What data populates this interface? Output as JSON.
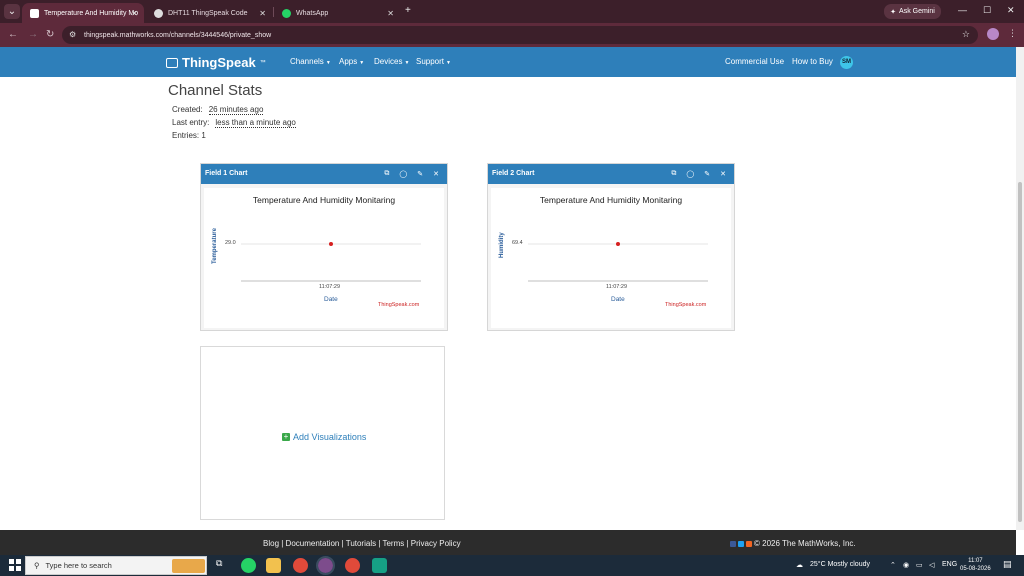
{
  "browser": {
    "tabs": [
      {
        "title": "Temperature And Humidity Mo",
        "active": true
      },
      {
        "title": "DHT11 ThingSpeak Code",
        "active": false
      },
      {
        "title": "WhatsApp",
        "active": false
      }
    ],
    "ask_gemini": "Ask Gemini",
    "url": "thingspeak.mathworks.com/channels/3444546/private_show"
  },
  "header": {
    "logo": "ThingSpeak",
    "logo_tm": "™",
    "menus": [
      "Channels",
      "Apps",
      "Devices",
      "Support"
    ],
    "right_links": [
      "Commercial Use",
      "How to Buy"
    ],
    "avatar_initials": "SM"
  },
  "channel_stats": {
    "title": "Channel Stats",
    "created_label": "Created:",
    "created_value": "26 minutes ago",
    "last_entry_label": "Last entry:",
    "last_entry_value": "less than a minute ago",
    "entries_label": "Entries: 1"
  },
  "charts": [
    {
      "panel_title": "Field 1 Chart",
      "chart_title": "Temperature And Humidity Monitaring",
      "ylabel": "Temperature",
      "y_tick": "29.0",
      "x_tick": "11:07:29",
      "xlabel": "Date",
      "credit": "ThingSpeak.com"
    },
    {
      "panel_title": "Field 2 Chart",
      "chart_title": "Temperature And Humidity Monitaring",
      "ylabel": "Humidity",
      "y_tick": "69.4",
      "x_tick": "11:07:29",
      "xlabel": "Date",
      "credit": "ThingSpeak.com"
    }
  ],
  "chart_data": [
    {
      "type": "scatter",
      "title": "Temperature And Humidity Monitaring",
      "xlabel": "Date",
      "ylabel": "Temperature",
      "x": [
        "11:07:29"
      ],
      "y": [
        29.0
      ],
      "point_color": "#d62020"
    },
    {
      "type": "scatter",
      "title": "Temperature And Humidity Monitaring",
      "xlabel": "Date",
      "ylabel": "Humidity",
      "x": [
        "11:07:29"
      ],
      "y": [
        69.4
      ],
      "point_color": "#d62020"
    }
  ],
  "add_visualizations": "Add Visualizations",
  "footer": {
    "links": "Blog | Documentation | Tutorials | Terms | Privacy Policy",
    "copyright": "© 2026 The MathWorks, Inc."
  },
  "taskbar": {
    "search_placeholder": "Type here to search",
    "weather": "25°C  Mostly cloudy",
    "lang": "ENG",
    "time": "11:07",
    "date": "05-08-2026"
  },
  "colors": {
    "brand": "#2e7fba",
    "chart_point": "#d62020",
    "credit": "#cc2222"
  }
}
